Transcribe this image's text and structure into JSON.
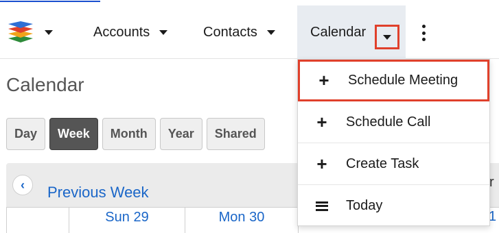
{
  "nav": {
    "items": [
      {
        "label": "Accounts"
      },
      {
        "label": "Contacts"
      },
      {
        "label": "Calendar"
      }
    ],
    "logo_icon": "sugar-cube-logo-icon",
    "more_icon": "vertical-dots-icon"
  },
  "page": {
    "title": "Calendar"
  },
  "view_buttons": [
    "Day",
    "Week",
    "Month",
    "Year",
    "Shared"
  ],
  "active_view": "Week",
  "calendar": {
    "prev_label": "Previous Week",
    "days": [
      "Sun 29",
      "Mon 30"
    ],
    "peek_right_header": "r",
    "peek_right_day": "1"
  },
  "dropdown": {
    "items": [
      {
        "label": "Schedule Meeting",
        "icon": "plus-icon"
      },
      {
        "label": "Schedule Call",
        "icon": "plus-icon"
      },
      {
        "label": "Create Task",
        "icon": "plus-icon"
      },
      {
        "label": "Today",
        "icon": "list-icon"
      }
    ]
  },
  "colors": {
    "highlight": "#e0402b",
    "link": "#1a66c8",
    "active_button": "#555555"
  }
}
